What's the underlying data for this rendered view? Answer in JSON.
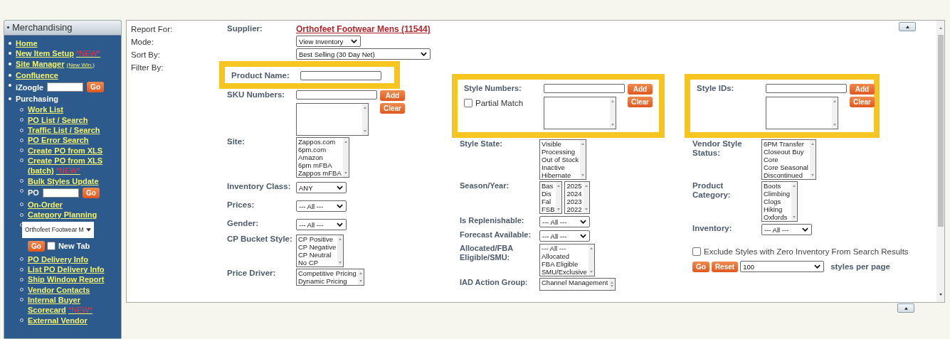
{
  "sidebar": {
    "title": "Merchandising",
    "items": [
      {
        "kind": "link",
        "label": "Home"
      },
      {
        "kind": "link",
        "label": "New Item Setup",
        "badge": "*NEW*"
      },
      {
        "kind": "link",
        "label": "Site Manager",
        "note": "(New Win.)"
      },
      {
        "kind": "link",
        "label": "Confluence"
      },
      {
        "kind": "search",
        "label": "iZoogle",
        "button": "Go"
      },
      {
        "kind": "heading",
        "label": "Purchasing",
        "children": [
          {
            "kind": "link",
            "label": "Work List"
          },
          {
            "kind": "link",
            "label": "PO List / Search"
          },
          {
            "kind": "link",
            "label": "Traffic List / Search"
          },
          {
            "kind": "link",
            "label": "PO Error Search"
          },
          {
            "kind": "link",
            "label": "Create PO from XLS"
          },
          {
            "kind": "link",
            "label": "Create PO from XLS (batch)",
            "badge": "*NEW*"
          },
          {
            "kind": "link",
            "label": "Bulk Styles Update"
          },
          {
            "kind": "search",
            "label": "PO",
            "button": "Go"
          },
          {
            "kind": "link",
            "label": "On-Order"
          },
          {
            "kind": "link",
            "label": "Category Planning"
          },
          {
            "kind": "select",
            "value": "Orthofeet Footwear M",
            "button": "Go",
            "option": {
              "label": "New Tab",
              "checked": false
            }
          },
          {
            "kind": "link",
            "label": "PO Delivery Info"
          },
          {
            "kind": "link",
            "label": "List PO Delivery Info"
          },
          {
            "kind": "link",
            "label": "Ship Window Report"
          },
          {
            "kind": "link",
            "label": "Vendor Contacts"
          },
          {
            "kind": "link",
            "label": "Internal Buyer Scorecard",
            "badge": "*NEW*"
          },
          {
            "kind": "link",
            "label": "External Vendor"
          }
        ]
      }
    ]
  },
  "form_labels": [
    "Report For:",
    "Mode:",
    "Sort By:",
    "Filter By:"
  ],
  "supplier": {
    "label": "Supplier:",
    "value": "Orthofeet Footwear Mens (11544)"
  },
  "mode": {
    "value": "View Inventory"
  },
  "sort_by": {
    "value": "Best Selling (30 Day Net)"
  },
  "columns": [
    [
      {
        "kind": "text",
        "label": "Product Name:",
        "highlighted": true
      },
      {
        "kind": "multi",
        "label": "SKU Numbers:",
        "add": "Add",
        "clear": "Clear",
        "highlighted": false
      },
      {
        "kind": "listbox",
        "label": "Site:",
        "lists": [
          [
            "Zappos.com",
            "6pm.com",
            "Amazon",
            "6pm mFBA",
            "Zappos mFBA"
          ]
        ]
      },
      {
        "kind": "select",
        "label": "Inventory Class:",
        "value": "ANY"
      },
      {
        "kind": "select",
        "label": "Prices:",
        "value": "--- All ---"
      },
      {
        "kind": "select",
        "label": "Gender:",
        "value": "--- All ---"
      },
      {
        "kind": "listbox",
        "label": "CP Bucket Style:",
        "lists": [
          [
            "CP Positive",
            "CP Negative",
            "CP Neutral",
            "No CP"
          ]
        ]
      },
      {
        "kind": "listbox",
        "label": "Price Driver:",
        "lists": [
          [
            "Competitive Pricing",
            "Dynamic Pricing"
          ]
        ]
      }
    ],
    [
      {
        "kind": "multi",
        "label": "Style Numbers:",
        "add": "Add",
        "clear": "Clear",
        "highlighted": true,
        "option": {
          "label": "Partial Match",
          "checked": false
        }
      },
      {
        "kind": "listbox",
        "label": "Style State:",
        "lists": [
          [
            "Visible",
            "Processing",
            "Out of Stock",
            "Inactive",
            "Hibernate"
          ]
        ]
      },
      {
        "kind": "listbox",
        "label": "Season/Year:",
        "lists": [
          [
            "Bas",
            "Dis",
            "Fal",
            "FSB"
          ],
          [
            "2025",
            "2024",
            "2023",
            "2022"
          ]
        ]
      },
      {
        "kind": "select",
        "label": "Is Replenishable:",
        "value": "--- All ---"
      },
      {
        "kind": "select",
        "label": "Forecast Available:",
        "value": "--- All ---"
      },
      {
        "kind": "listbox",
        "label": "Allocated/FBA Eligible/SMU:",
        "lists": [
          [
            "--- All ---",
            "Allocated",
            "FBA Eligible",
            "SMU/Exclusive"
          ]
        ]
      },
      {
        "kind": "listbox",
        "label": "IAD Action Group:",
        "lists": [
          [
            "Channel Management"
          ]
        ]
      }
    ],
    [
      {
        "kind": "multi",
        "label": "Style IDs:",
        "add": "Add",
        "clear": "Clear",
        "highlighted": true
      },
      {
        "kind": "listbox",
        "label": "Vendor Style Status:",
        "lists": [
          [
            "6PM Transfer",
            "Closeout Buy",
            "Core",
            "Core Seasonal",
            "Discontinued"
          ]
        ]
      },
      {
        "kind": "listbox",
        "label": "Product Category:",
        "lists": [
          [
            "Boots",
            "Climbing",
            "Clogs",
            "Hiking",
            "Oxfords"
          ]
        ]
      },
      {
        "kind": "select",
        "label": "Inventory:",
        "value": "--- All ---"
      },
      {
        "kind": "checkbox",
        "label": "Exclude Styles with Zero Inventory From Search Results",
        "checked": false
      },
      {
        "kind": "footer",
        "go": "Go",
        "reset": "Reset",
        "page_size": {
          "value": "100",
          "label": "styles per page"
        }
      }
    ]
  ]
}
